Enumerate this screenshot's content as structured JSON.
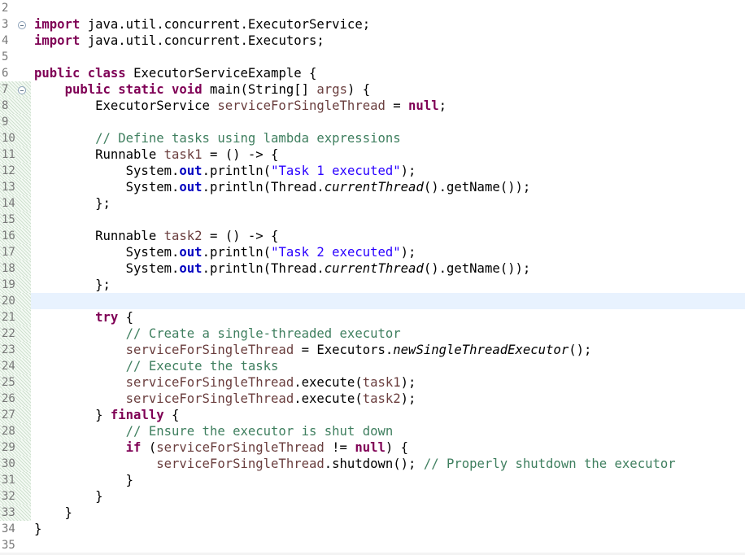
{
  "editor": {
    "lines": [
      {
        "num": "2",
        "text": "",
        "fold": false,
        "marked": false,
        "current": false
      },
      {
        "num": "3",
        "text": "import java.util.concurrent.ExecutorService;",
        "fold": true,
        "marked": false,
        "current": false
      },
      {
        "num": "4",
        "text": "import java.util.concurrent.Executors;",
        "fold": false,
        "marked": false,
        "current": false
      },
      {
        "num": "5",
        "text": "",
        "fold": false,
        "marked": false,
        "current": false
      },
      {
        "num": "6",
        "text": "public class ExecutorServiceExample {",
        "fold": false,
        "marked": false,
        "current": false
      },
      {
        "num": "7",
        "text": "    public static void main(String[] args) {",
        "fold": true,
        "marked": true,
        "current": false
      },
      {
        "num": "8",
        "text": "        ExecutorService serviceForSingleThread = null;",
        "fold": false,
        "marked": true,
        "current": false
      },
      {
        "num": "9",
        "text": "",
        "fold": false,
        "marked": true,
        "current": false
      },
      {
        "num": "10",
        "text": "        // Define tasks using lambda expressions",
        "fold": false,
        "marked": true,
        "current": false
      },
      {
        "num": "11",
        "text": "        Runnable task1 = () -> {",
        "fold": false,
        "marked": true,
        "current": false
      },
      {
        "num": "12",
        "text": "            System.out.println(\"Task 1 executed\");",
        "fold": false,
        "marked": true,
        "current": false
      },
      {
        "num": "13",
        "text": "            System.out.println(Thread.currentThread().getName());",
        "fold": false,
        "marked": true,
        "current": false
      },
      {
        "num": "14",
        "text": "        };",
        "fold": false,
        "marked": true,
        "current": false
      },
      {
        "num": "15",
        "text": "",
        "fold": false,
        "marked": true,
        "current": false
      },
      {
        "num": "16",
        "text": "        Runnable task2 = () -> {",
        "fold": false,
        "marked": true,
        "current": false
      },
      {
        "num": "17",
        "text": "            System.out.println(\"Task 2 executed\");",
        "fold": false,
        "marked": true,
        "current": false
      },
      {
        "num": "18",
        "text": "            System.out.println(Thread.currentThread().getName());",
        "fold": false,
        "marked": true,
        "current": false
      },
      {
        "num": "19",
        "text": "        };",
        "fold": false,
        "marked": true,
        "current": false
      },
      {
        "num": "20",
        "text": "",
        "fold": false,
        "marked": true,
        "current": true
      },
      {
        "num": "21",
        "text": "        try {",
        "fold": false,
        "marked": true,
        "current": false
      },
      {
        "num": "22",
        "text": "            // Create a single-threaded executor",
        "fold": false,
        "marked": true,
        "current": false
      },
      {
        "num": "23",
        "text": "            serviceForSingleThread = Executors.newSingleThreadExecutor();",
        "fold": false,
        "marked": true,
        "current": false
      },
      {
        "num": "24",
        "text": "            // Execute the tasks",
        "fold": false,
        "marked": true,
        "current": false
      },
      {
        "num": "25",
        "text": "            serviceForSingleThread.execute(task1);",
        "fold": false,
        "marked": true,
        "current": false
      },
      {
        "num": "26",
        "text": "            serviceForSingleThread.execute(task2);",
        "fold": false,
        "marked": true,
        "current": false
      },
      {
        "num": "27",
        "text": "        } finally {",
        "fold": false,
        "marked": true,
        "current": false
      },
      {
        "num": "28",
        "text": "            // Ensure the executor is shut down",
        "fold": false,
        "marked": true,
        "current": false
      },
      {
        "num": "29",
        "text": "            if (serviceForSingleThread != null) {",
        "fold": false,
        "marked": true,
        "current": false
      },
      {
        "num": "30",
        "text": "                serviceForSingleThread.shutdown(); // Properly shutdown the executor",
        "fold": false,
        "marked": true,
        "current": false
      },
      {
        "num": "31",
        "text": "            }",
        "fold": false,
        "marked": true,
        "current": false
      },
      {
        "num": "32",
        "text": "        }",
        "fold": false,
        "marked": true,
        "current": false
      },
      {
        "num": "33",
        "text": "    }",
        "fold": false,
        "marked": true,
        "current": false
      },
      {
        "num": "34",
        "text": "}",
        "fold": false,
        "marked": false,
        "current": false
      },
      {
        "num": "35",
        "text": "",
        "fold": false,
        "marked": false,
        "current": false
      }
    ],
    "colors": {
      "keyword": "#7f0055",
      "comment": "#3f7f5f",
      "string": "#2a00ff",
      "static_field": "#0000c0",
      "local_variable": "#6a3e3e",
      "current_line": "#e8f2fe",
      "line_number": "#787878"
    }
  }
}
